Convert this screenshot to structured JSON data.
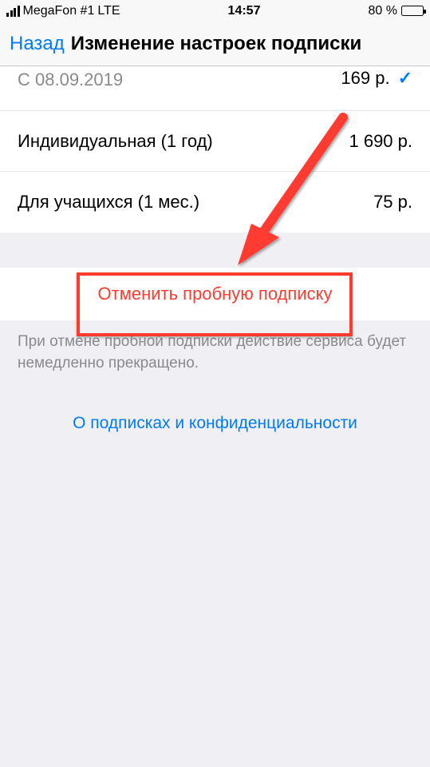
{
  "status": {
    "carrier": "MegaFon #1",
    "network": "LTE",
    "time": "14:57",
    "battery_pct": "80 %"
  },
  "nav": {
    "back": "Назад",
    "title": "Изменение настроек подписки"
  },
  "plans": {
    "current": {
      "price": "169 р.",
      "from": "С 08.09.2019"
    },
    "yearly": {
      "label": "Индивидуальная (1 год)",
      "price": "1 690 р."
    },
    "student": {
      "label": "Для учащихся (1 мес.)",
      "price": "75 р."
    }
  },
  "cancel": {
    "label": "Отменить пробную подписку"
  },
  "note": "При отмене пробной подписки действие сервиса будет немедленно прекращено.",
  "about": "О подписках и конфиденциальности"
}
